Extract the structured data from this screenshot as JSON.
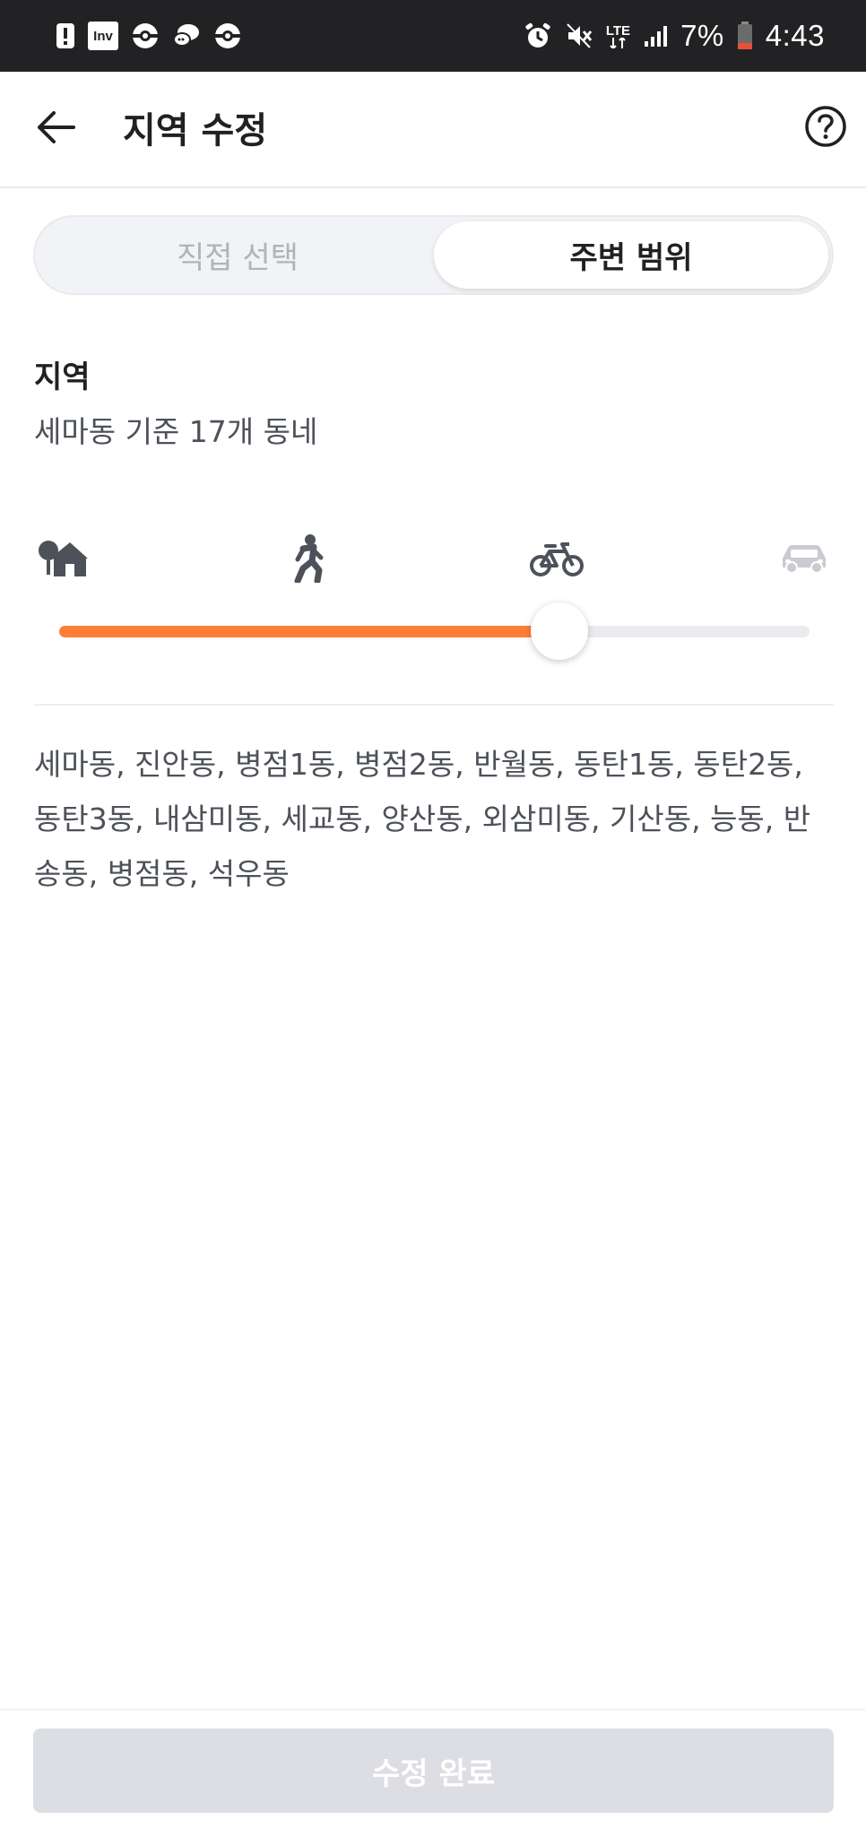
{
  "status_bar": {
    "left_icons": [
      "alert-icon",
      "inv-icon",
      "pokeball-icon",
      "chat-icon",
      "pokeball-icon"
    ],
    "inv_label": "Inv",
    "network_label": "LTE",
    "battery_percent": "7%",
    "time": "4:43"
  },
  "header": {
    "title": "지역 수정",
    "back_icon": "back-arrow-icon",
    "help_icon": "help-circle-icon"
  },
  "tabs": {
    "direct_label": "직접 선택",
    "range_label": "주변 범위",
    "active": "range"
  },
  "region": {
    "label": "지역",
    "summary": "세마동 기준 17개 동네"
  },
  "range": {
    "icons": [
      "home-icon",
      "walk-icon",
      "bike-icon",
      "car-icon"
    ],
    "level": 0.667,
    "accent_color": "#ff7e36",
    "track_color": "#eaebee"
  },
  "dongs": {
    "text": "세마동, 진안동, 병점1동, 병점2동, 반월동, 동탄1동, 동탄2동, 동탄3동, 내삼미동, 세교동, 양산동, 외삼미동, 기산동, 능동, 반송동, 병점동, 석우동"
  },
  "footer": {
    "submit_label": "수정 완료",
    "submit_color": "#dcdee3"
  }
}
